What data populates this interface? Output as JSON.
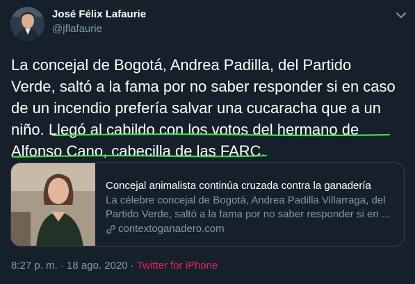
{
  "author": {
    "display_name": "José Félix Lafaurie",
    "username": "@jflafaurie"
  },
  "tweet": {
    "lines": [
      "La concejal de Bogotá, Andrea Padilla, del Partido",
      "Verde, saltó a la fama por no saber responder si en caso",
      "de un incendio prefería salvar una cucaracha que a un",
      "niño. Llegó al cabildo con los votos del hermano de",
      "Alfonso Cano, cabecilla de las FARC."
    ],
    "highlight_color": "#3fdc4a"
  },
  "card": {
    "title": "Concejal animalista continúa cruzada contra la ganadería",
    "description_lines": [
      "La célebre concejal de Bogotá, Andrea Padilla Villarraga, del",
      "Partido Verde, saltó a la fama por no saber responder si en ..."
    ],
    "domain": "contextoganadero.com"
  },
  "meta": {
    "time": "8:27 p. m.",
    "separator": " · ",
    "date": "18 ago. 2020",
    "dot": " · ",
    "source": "Twitter for iPhone"
  },
  "icons": {
    "menu": "chevron-down-icon",
    "link": "link-icon"
  },
  "colors": {
    "background": "#15202b",
    "text": "#ffffff",
    "secondary_text": "#8899a6",
    "border": "#38444d",
    "source_link": "#e0245e"
  }
}
